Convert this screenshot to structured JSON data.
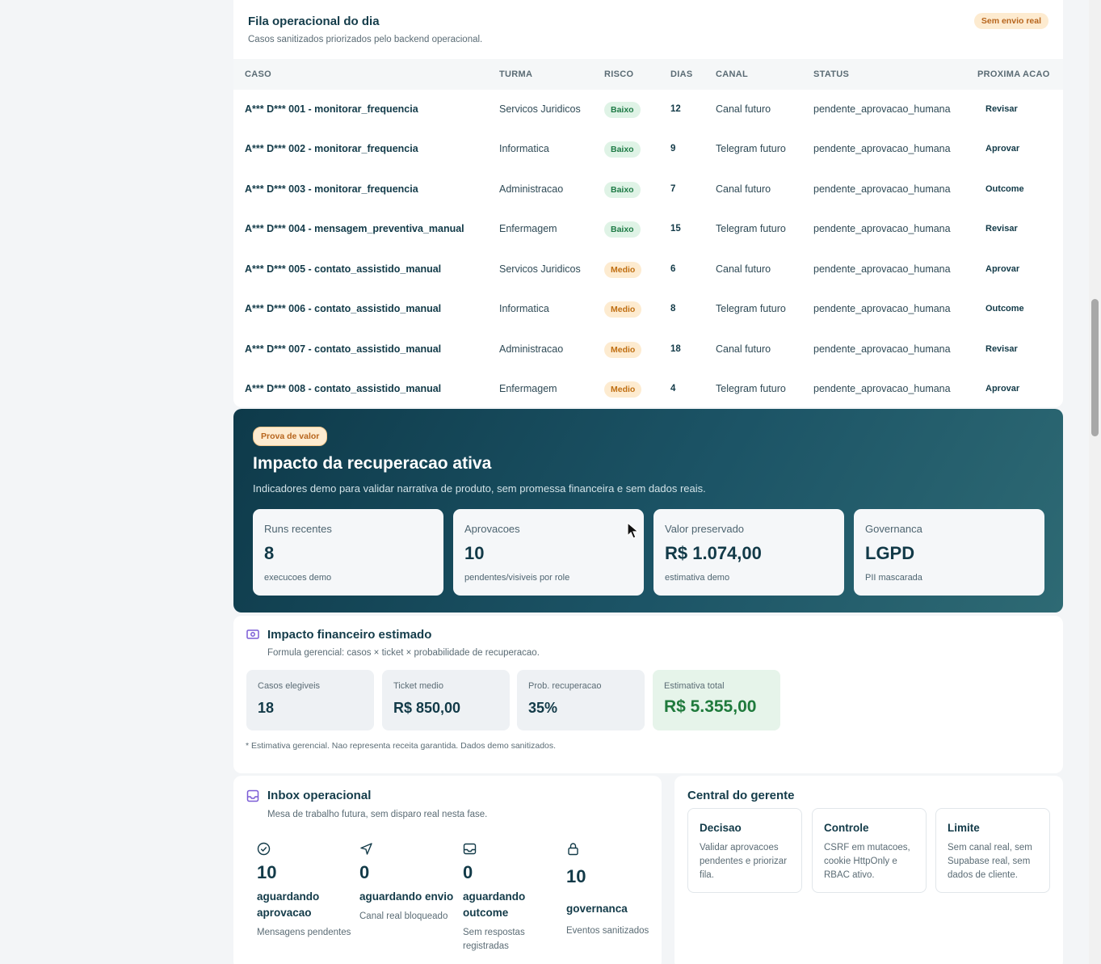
{
  "fila": {
    "title": "Fila operacional do dia",
    "subtitle": "Casos sanitizados priorizados pelo backend operacional.",
    "badge": "Sem envio real",
    "columns": [
      "CASO",
      "TURMA",
      "RISCO",
      "DIAS",
      "CANAL",
      "STATUS",
      "PROXIMA ACAO"
    ],
    "rows": [
      {
        "caso": "A*** D*** 001 - monitorar_frequencia",
        "turma": "Servicos Juridicos",
        "risco": "Baixo",
        "dias": "12",
        "canal": "Canal futuro",
        "status": "pendente_aprovacao_humana",
        "acao": "Revisar"
      },
      {
        "caso": "A*** D*** 002 - monitorar_frequencia",
        "turma": "Informatica",
        "risco": "Baixo",
        "dias": "9",
        "canal": "Telegram futuro",
        "status": "pendente_aprovacao_humana",
        "acao": "Aprovar"
      },
      {
        "caso": "A*** D*** 003 - monitorar_frequencia",
        "turma": "Administracao",
        "risco": "Baixo",
        "dias": "7",
        "canal": "Canal futuro",
        "status": "pendente_aprovacao_humana",
        "acao": "Outcome"
      },
      {
        "caso": "A*** D*** 004 - mensagem_preventiva_manual",
        "turma": "Enfermagem",
        "risco": "Baixo",
        "dias": "15",
        "canal": "Telegram futuro",
        "status": "pendente_aprovacao_humana",
        "acao": "Revisar"
      },
      {
        "caso": "A*** D*** 005 - contato_assistido_manual",
        "turma": "Servicos Juridicos",
        "risco": "Medio",
        "dias": "6",
        "canal": "Canal futuro",
        "status": "pendente_aprovacao_humana",
        "acao": "Aprovar"
      },
      {
        "caso": "A*** D*** 006 - contato_assistido_manual",
        "turma": "Informatica",
        "risco": "Medio",
        "dias": "8",
        "canal": "Telegram futuro",
        "status": "pendente_aprovacao_humana",
        "acao": "Outcome"
      },
      {
        "caso": "A*** D*** 007 - contato_assistido_manual",
        "turma": "Administracao",
        "risco": "Medio",
        "dias": "18",
        "canal": "Canal futuro",
        "status": "pendente_aprovacao_humana",
        "acao": "Revisar"
      },
      {
        "caso": "A*** D*** 008 - contato_assistido_manual",
        "turma": "Enfermagem",
        "risco": "Medio",
        "dias": "4",
        "canal": "Telegram futuro",
        "status": "pendente_aprovacao_humana",
        "acao": "Aprovar"
      }
    ]
  },
  "impacto": {
    "badge": "Prova de valor",
    "title": "Impacto da recuperacao ativa",
    "subtitle": "Indicadores demo para validar narrativa de produto, sem promessa financeira e sem dados reais.",
    "kpis": [
      {
        "label": "Runs recentes",
        "value": "8",
        "sub": "execucoes demo"
      },
      {
        "label": "Aprovacoes",
        "value": "10",
        "sub": "pendentes/visiveis por role"
      },
      {
        "label": "Valor preservado",
        "value": "R$ 1.074,00",
        "sub": "estimativa demo"
      },
      {
        "label": "Governanca",
        "value": "LGPD",
        "sub": "PII mascarada"
      }
    ]
  },
  "financeiro": {
    "icon": "money-icon",
    "title": "Impacto financeiro estimado",
    "subtitle": "Formula gerencial: casos × ticket × probabilidade de recuperacao.",
    "boxes": [
      {
        "label": "Casos elegiveis",
        "value": "18"
      },
      {
        "label": "Ticket medio",
        "value": "R$ 850,00"
      },
      {
        "label": "Prob. recuperacao",
        "value": "35%"
      },
      {
        "label": "Estimativa total",
        "value": "R$ 5.355,00"
      }
    ],
    "note": "* Estimativa gerencial. Nao representa receita garantida. Dados demo sanitizados."
  },
  "inbox": {
    "icon": "inbox-icon",
    "title": "Inbox operacional",
    "subtitle": "Mesa de trabalho futura, sem disparo real nesta fase.",
    "stats": [
      {
        "icon": "check-circle-icon",
        "value": "10",
        "title": "aguardando aprovacao",
        "desc": "Mensagens pendentes"
      },
      {
        "icon": "send-icon",
        "value": "0",
        "title": "aguardando envio",
        "desc": "Canal real bloqueado"
      },
      {
        "icon": "inbox-tray-icon",
        "value": "0",
        "title": "aguardando outcome",
        "desc": "Sem respostas registradas"
      },
      {
        "icon": "lock-icon",
        "value": "10",
        "title": "governanca",
        "desc": "Eventos sanitizados"
      }
    ]
  },
  "central": {
    "title": "Central do gerente",
    "boxes": [
      {
        "title": "Decisao",
        "desc": "Validar aprovacoes pendentes e priorizar fila."
      },
      {
        "title": "Controle",
        "desc": "CSRF em mutacoes, cookie HttpOnly e RBAC ativo."
      },
      {
        "title": "Limite",
        "desc": "Sem canal real, sem Supabase real, sem dados de cliente."
      }
    ]
  },
  "colors": {
    "accent": "#123a48",
    "risk_low_bg": "#dff3e6",
    "risk_medium_bg": "#fdebd0",
    "hero_gradient_start": "#0e3a4a",
    "hero_gradient_end": "#2e6a74",
    "total_green": "#1f7a3c"
  }
}
